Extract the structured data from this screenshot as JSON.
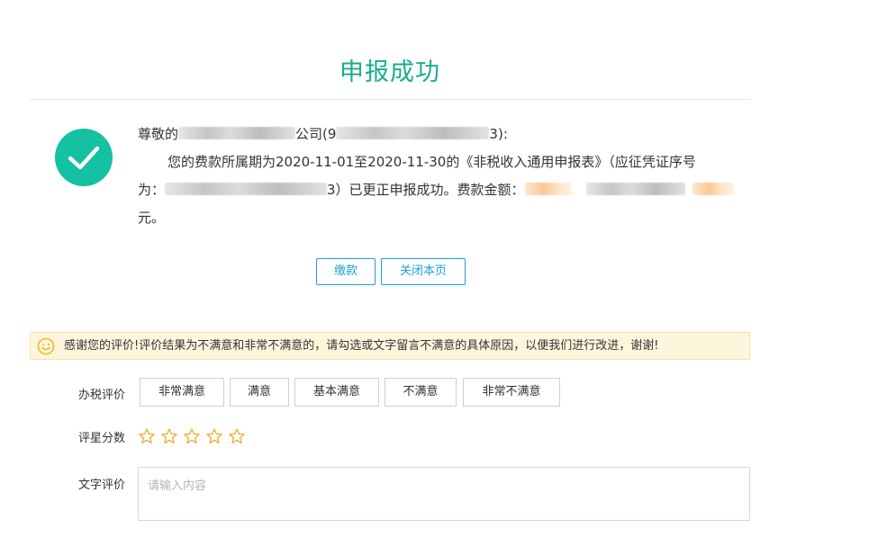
{
  "page": {
    "title": "申报成功"
  },
  "message": {
    "salutation_prefix": "尊敬的",
    "salutation_company": "公司(9",
    "salutation_suffix": "3):",
    "body_line1": "您的费款所属期为2020-11-01至2020-11-30的《非税收入通用申报表》（应征凭证序号",
    "body_line2_prefix": "为：",
    "body_line2_mid": "3）已更正申报成功。费款金额：",
    "body_line3": "元。"
  },
  "buttons": {
    "pay": "缴款",
    "close": "关闭本页"
  },
  "notice": {
    "text": "感谢您的评价!评价结果为不满意和非常不满意的，请勾选或文字留言不满意的具体原因，以便我们进行改进，谢谢!"
  },
  "rating": {
    "label": "办税评价",
    "options": [
      "非常满意",
      "满意",
      "基本满意",
      "不满意",
      "非常不满意"
    ]
  },
  "stars": {
    "label": "评星分数",
    "count": 5,
    "selected": 0,
    "color": "#f5a623"
  },
  "comment": {
    "label": "文字评价",
    "placeholder": "请输入内容"
  },
  "colors": {
    "accent_green": "#1aad8f",
    "check_bg": "#14c1a2",
    "button_blue": "#1e9fd6",
    "notice_bg": "#fdf6dd"
  }
}
